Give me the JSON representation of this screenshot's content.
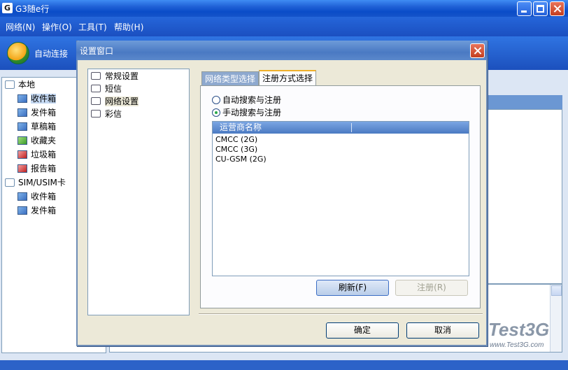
{
  "app": {
    "icon_letter": "G",
    "title": "G3随e行"
  },
  "menu": [
    {
      "label": "网络(N)"
    },
    {
      "label": "操作(O)"
    },
    {
      "label": "工具(T)"
    },
    {
      "label": "帮助(H)"
    }
  ],
  "toolbar": {
    "connect_label": "自动连接"
  },
  "left_tree": {
    "local": "本地",
    "items": [
      "收件箱",
      "发件箱",
      "草稿箱",
      "收藏夹",
      "垃圾箱",
      "报告箱"
    ],
    "sim": "SIM/USIM卡",
    "sim_items": [
      "收件箱",
      "发件箱"
    ]
  },
  "dialog": {
    "title": "设置窗口",
    "nav": [
      "常规设置",
      "短信",
      "网络设置",
      "彩信"
    ],
    "selected_nav": "网络设置",
    "tabs": [
      "网络类型选择",
      "注册方式选择"
    ],
    "active_tab": "注册方式选择",
    "radios": [
      {
        "label": "自动搜索与注册",
        "checked": false
      },
      {
        "label": "手动搜索与注册",
        "checked": true
      }
    ],
    "list_header": "运营商名称",
    "operators": [
      "CMCC (2G)",
      "CMCC (3G)",
      "CU-GSM (2G)"
    ],
    "refresh_button": "刷新(F)",
    "register_button": "注册(R)",
    "ok_button": "确定",
    "cancel_button": "取消"
  },
  "watermark": {
    "brand": "Test3G",
    "url": "www.Test3G.com"
  },
  "colors": {
    "xp_blue": "#0a4cc8",
    "accent_tab": "#f0b02a",
    "close_red": "#c33e1f"
  }
}
